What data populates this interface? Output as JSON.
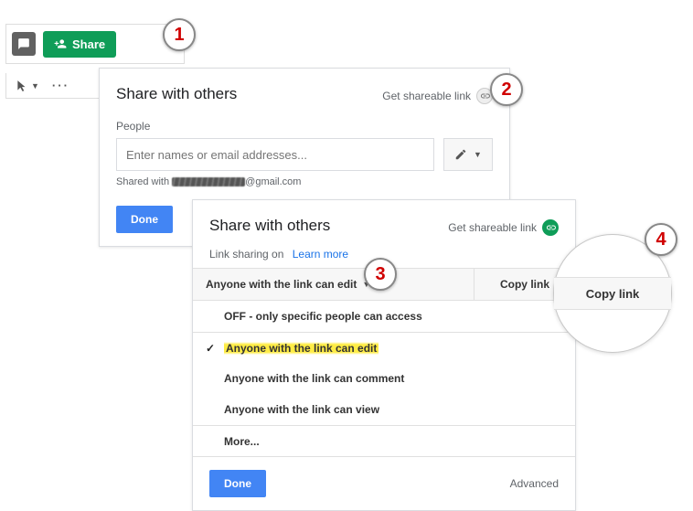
{
  "callouts": {
    "one": "1",
    "two": "2",
    "three": "3",
    "four": "4"
  },
  "toolbar": {
    "share_label": "Share"
  },
  "dialog1": {
    "title": "Share with others",
    "get_link": "Get shareable link",
    "people_label": "People",
    "people_placeholder": "Enter names or email addresses...",
    "shared_with_suffix": "@gmail.com",
    "done": "Done"
  },
  "dialog2": {
    "title": "Share with others",
    "get_link": "Get shareable link",
    "link_sharing_on": "Link sharing on",
    "learn_more": "Learn more",
    "selector_label": "Anyone with the link can edit",
    "copy_link": "Copy link",
    "menu": {
      "off": "OFF - only specific people can access",
      "edit": "Anyone with the link can edit",
      "comment": "Anyone with the link can comment",
      "view": "Anyone with the link can view",
      "more": "More..."
    },
    "done": "Done",
    "advanced": "Advanced"
  },
  "zoom": {
    "copy_link": "Copy link"
  },
  "colors": {
    "green": "#0f9d58",
    "blue": "#4285f4",
    "red": "#d00000",
    "highlight": "#ffeb3b"
  }
}
